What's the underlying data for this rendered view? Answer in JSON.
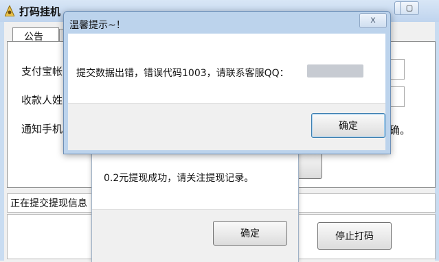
{
  "main_window": {
    "title": "打码挂机",
    "tab_label": "公告",
    "fields": [
      "支付宝帐",
      "收款人姓",
      "通知手机"
    ],
    "trailing_char": "确。",
    "status_text": "正在提交提现信息",
    "stop_button": "停止打码",
    "controls": {
      "minimize": "▁",
      "maximize": "▢"
    }
  },
  "error_dialog": {
    "title": "温馨提示~！",
    "close_glyph": "x",
    "message": "提交数据出错，错误代码1003，请联系客服QQ：",
    "ok_button": "确定"
  },
  "success_dialog": {
    "message": "0.2元提现成功，请关注提现记录。",
    "ok_button": "确定"
  }
}
